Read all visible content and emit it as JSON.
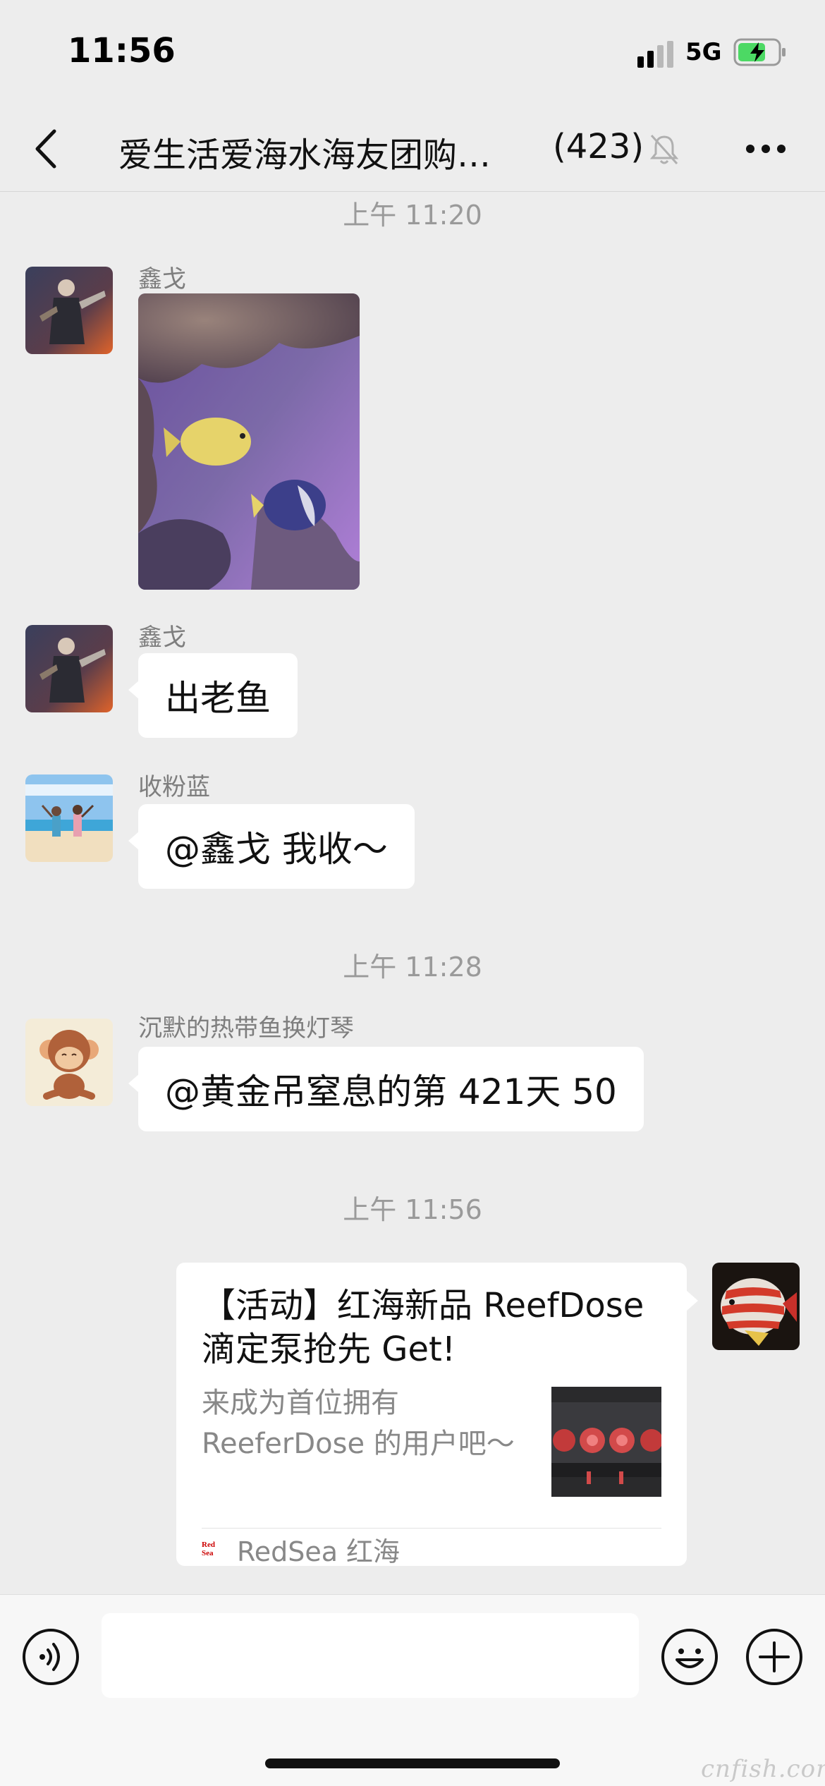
{
  "status_bar": {
    "time": "11:56",
    "network": "5G",
    "icons": [
      "signal-icon",
      "battery-charging-icon"
    ]
  },
  "nav": {
    "title": "爱生活爱海水海友团购…",
    "member_count": "(423)",
    "icons": [
      "back-chevron-icon",
      "mute-bell-icon",
      "more-dots-icon"
    ]
  },
  "messages": {
    "timestamp_1": "上午 11:20",
    "msg1_sender": "鑫戈",
    "msg2_sender": "鑫戈",
    "msg2_text": "出老鱼",
    "msg3_sender": "收粉蓝",
    "msg3_text": "@鑫戈 我收～",
    "timestamp_2": "上午 11:28",
    "msg4_sender": "沉默的热带鱼换灯琴",
    "msg4_text": "@黄金吊窒息的第 421天 50",
    "timestamp_3": "上午 11:56"
  },
  "card": {
    "title": "【活动】红海新品 ReefDose 滴定泵抢先 Get!",
    "description": "来成为首位拥有 ReeferDose 的用户吧～",
    "source_logo_text": "Red Sea",
    "source_name": "RedSea 红海"
  },
  "input_bar": {
    "icons": [
      "voice-icon",
      "emoji-icon",
      "plus-icon"
    ]
  },
  "watermark": "cnfish.com",
  "colors": {
    "background": "#ededed",
    "bubble": "#ffffff",
    "timestamp": "#9a9a9a"
  }
}
